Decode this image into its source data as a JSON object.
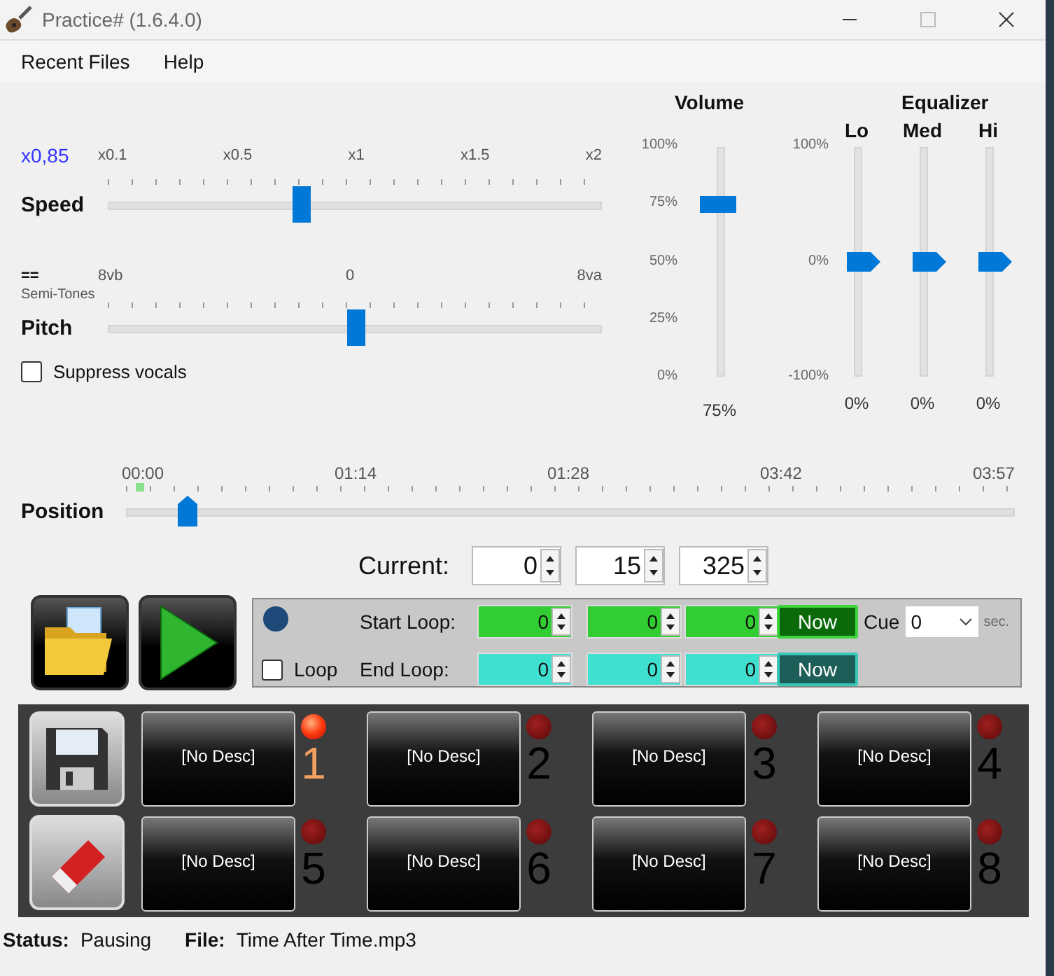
{
  "window": {
    "title": "Practice# (1.6.4.0)"
  },
  "menu": [
    {
      "label": "Recent Files"
    },
    {
      "label": "Help"
    }
  ],
  "speed": {
    "value": "x0,85",
    "label": "Speed",
    "ticks": [
      "x0.1",
      "x0.5",
      "x1",
      "x1.5",
      "x2"
    ],
    "level": 0.39
  },
  "pitch": {
    "value": "==",
    "unit": "Semi-Tones",
    "label": "Pitch",
    "ticks": [
      "8vb",
      "0",
      "8va"
    ],
    "level": 0.5
  },
  "suppress_vocals": {
    "label": "Suppress vocals",
    "checked": false
  },
  "volume": {
    "title": "Volume",
    "scale": [
      "100%",
      "75%",
      "50%",
      "25%",
      "0%"
    ],
    "level": 0.75,
    "reading": "75%"
  },
  "equalizer": {
    "title": "Equalizer",
    "scale": [
      "100%",
      "0%",
      "-100%"
    ],
    "bands": [
      {
        "name": "Lo",
        "level": 0.5,
        "reading": "0%"
      },
      {
        "name": "Med",
        "level": 0.5,
        "reading": "0%"
      },
      {
        "name": "Hi",
        "level": 0.5,
        "reading": "0%"
      }
    ]
  },
  "position": {
    "label": "Position",
    "ticks": [
      "00:00",
      "01:14",
      "01:28",
      "03:42",
      "03:57"
    ],
    "level": 0.07
  },
  "current": {
    "label": "Current:",
    "fields": [
      "0",
      "15",
      "325"
    ]
  },
  "loop": {
    "label": "Loop",
    "checked": false,
    "start_label": "Start Loop:",
    "start": [
      "0",
      "0",
      "0"
    ],
    "end_label": "End Loop:",
    "end": [
      "0",
      "0",
      "0"
    ],
    "now_buttons": [
      "Now",
      "Now"
    ],
    "cue_label": "Cue",
    "cue_value": "0",
    "cue_unit": "sec."
  },
  "slots": [
    {
      "label": "[No Desc]",
      "number": "1",
      "selected": true
    },
    {
      "label": "[No Desc]",
      "number": "2",
      "selected": false
    },
    {
      "label": "[No Desc]",
      "number": "3",
      "selected": false
    },
    {
      "label": "[No Desc]",
      "number": "4",
      "selected": false
    },
    {
      "label": "[No Desc]",
      "number": "5",
      "selected": false
    },
    {
      "label": "[No Desc]",
      "number": "6",
      "selected": false
    },
    {
      "label": "[No Desc]",
      "number": "7",
      "selected": false
    },
    {
      "label": "[No Desc]",
      "number": "8",
      "selected": false
    }
  ],
  "status_bar": {
    "status_label": "Status:",
    "status": "Pausing",
    "file_label": "File:",
    "file": "Time After Time.mp3"
  }
}
